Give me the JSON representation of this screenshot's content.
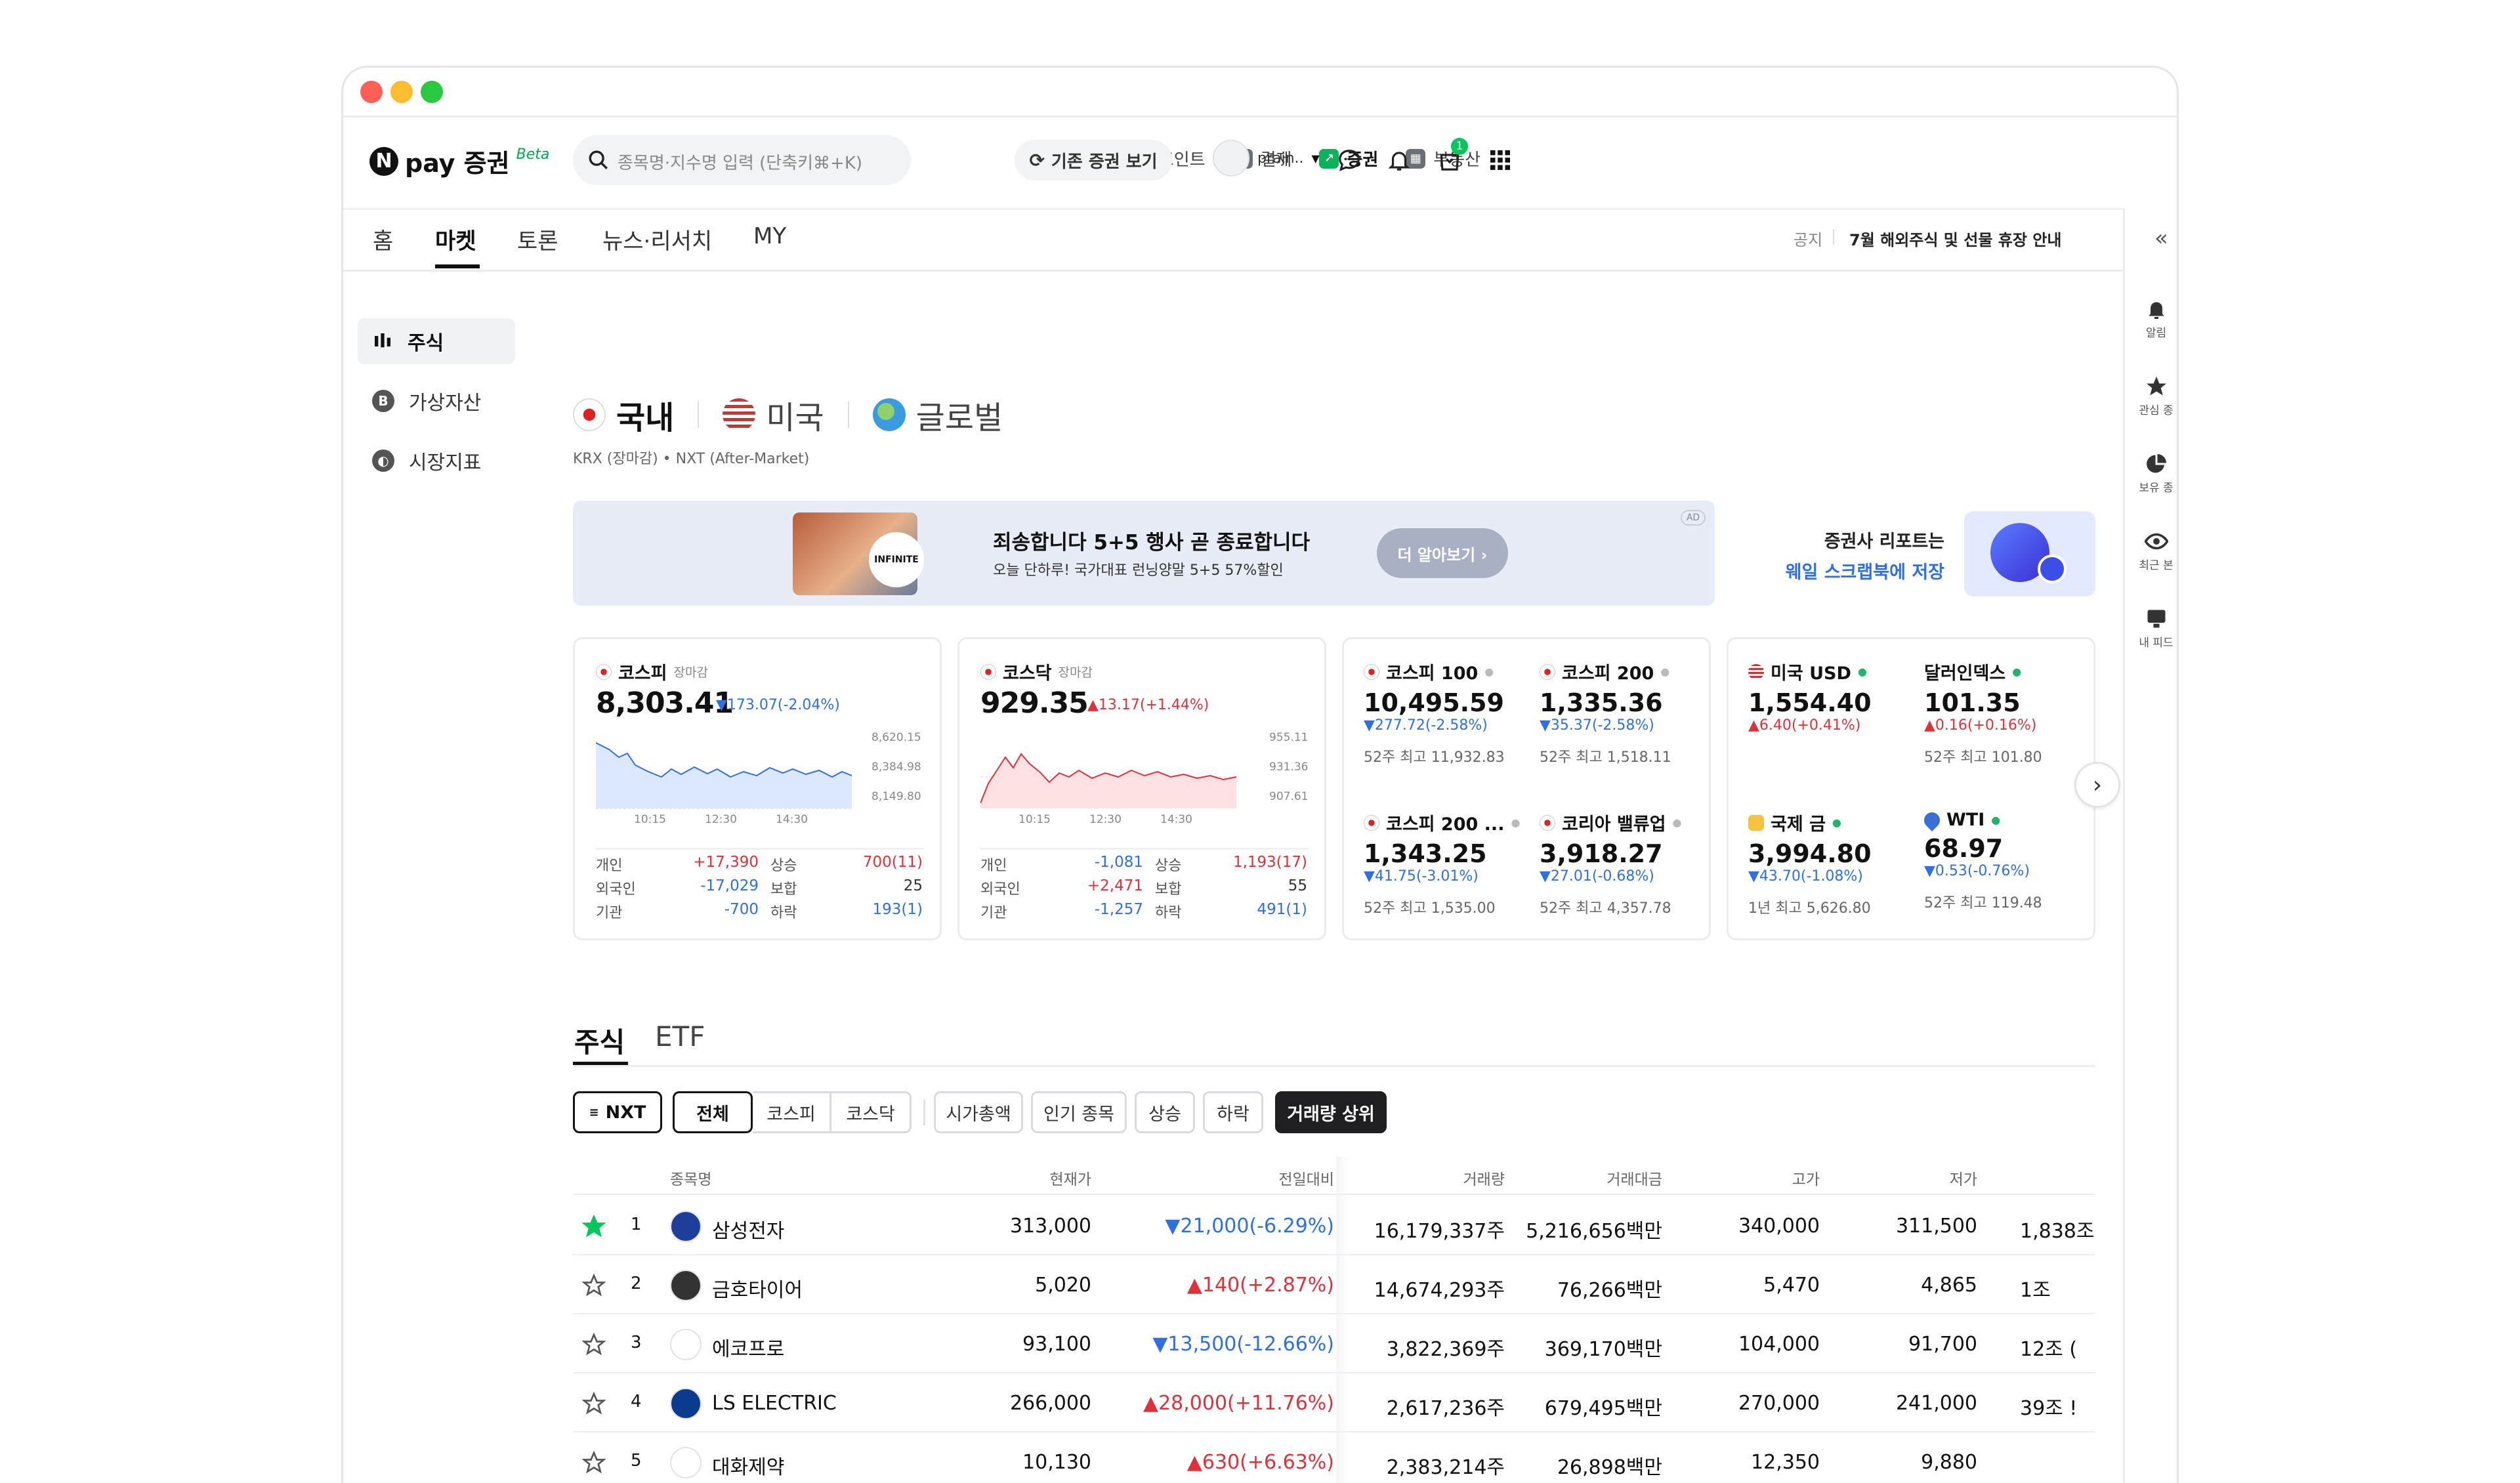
{
  "header": {
    "logo": "pay 증권",
    "logo_badge": "Beta",
    "search_placeholder": "종목명·지수명 입력 (단축키⌘+K)",
    "gnb": [
      {
        "label": "금융",
        "icon": "finance-icon"
      },
      {
        "label": "포인트",
        "icon": "point-icon"
      },
      {
        "label": "결제",
        "icon": "payment-icon"
      },
      {
        "label": "증권",
        "icon": "stock-icon"
      },
      {
        "label": "부동산",
        "icon": "realestate-icon"
      }
    ],
    "legacy_button": "기존 증권 보기",
    "user": "prajn..",
    "notification_badge": "1"
  },
  "tabs": [
    "홈",
    "마켓",
    "토론",
    "뉴스·리서치",
    "MY"
  ],
  "notice": {
    "label": "공지",
    "text": "7월 해외주식 및 선물 휴장 안내"
  },
  "left_nav": [
    "주식",
    "가상자산",
    "시장지표"
  ],
  "markets": [
    "국내",
    "미국",
    "글로벌"
  ],
  "market_sub": "KRX (장마감) • NXT (After-Market)",
  "banner": {
    "title": "죄송합니다 5+5 행사 곧 종료합니다",
    "subtitle": "오늘 단하루! 국가대표 런닝양말 5+5 57%할인",
    "button": "더 알아보기 ›",
    "ad": "AD",
    "brand": "INFINITE",
    "right_line1": "증권사 리포트는",
    "right_line2": "웨일 스크랩북에 저장"
  },
  "cards": {
    "kospi": {
      "name": "코스피",
      "status": "장마감",
      "value": "8,303.41",
      "change": "▼173.07(-2.04%)",
      "yticks": [
        "8,620.15",
        "8,384.98",
        "8,149.80"
      ],
      "xticks": [
        "10:15",
        "12:30",
        "14:30"
      ],
      "stats": [
        [
          "개인",
          "+17,390",
          "상승",
          "700(11)"
        ],
        [
          "외국인",
          "-17,029",
          "보합",
          "25"
        ],
        [
          "기관",
          "-700",
          "하락",
          "193(1)"
        ]
      ]
    },
    "kosdaq": {
      "name": "코스닥",
      "status": "장마감",
      "value": "929.35",
      "change": "▲13.17(+1.44%)",
      "yticks": [
        "955.11",
        "931.36",
        "907.61"
      ],
      "xticks": [
        "10:15",
        "12:30",
        "14:30"
      ],
      "stats": [
        [
          "개인",
          "-1,081",
          "상승",
          "1,193(17)"
        ],
        [
          "외국인",
          "+2,471",
          "보합",
          "55"
        ],
        [
          "기관",
          "-1,257",
          "하락",
          "491(1)"
        ]
      ]
    },
    "indices": [
      {
        "name": "코스피 100",
        "value": "10,495.59",
        "change": "▼277.72(-2.58%)",
        "w52": "52주 최고 11,932.83"
      },
      {
        "name": "코스피 200",
        "value": "1,335.36",
        "change": "▼35.37(-2.58%)",
        "w52": "52주 최고 1,518.11"
      },
      {
        "name": "코스피 200 ...",
        "value": "1,343.25",
        "change": "▼41.75(-3.01%)",
        "w52": "52주 최고 1,535.00"
      },
      {
        "name": "코리아 밸류업",
        "value": "3,918.27",
        "change": "▼27.01(-0.68%)",
        "w52": "52주 최고 4,357.78"
      }
    ],
    "fx": [
      {
        "name": "미국 USD",
        "value": "1,554.40",
        "change": "▲6.40(+0.41%)",
        "w52": ""
      },
      {
        "name": "달러인덱스",
        "value": "101.35",
        "change": "▲0.16(+0.16%)",
        "w52": "52주 최고 101.80"
      },
      {
        "name": "국제 금",
        "value": "3,994.80",
        "change": "▼43.70(-1.08%)",
        "w52": "1년 최고 5,626.80"
      },
      {
        "name": "WTI",
        "value": "68.97",
        "change": "▼0.53(-0.76%)",
        "w52": "52주 최고 119.48"
      }
    ]
  },
  "section_tabs": [
    "주식",
    "ETF"
  ],
  "filters": [
    "NXT",
    "전체",
    "코스피",
    "코스닥",
    "시가총액",
    "인기 종목",
    "상승",
    "하락",
    "거래량 상위"
  ],
  "table": {
    "headers": [
      "종목명",
      "현재가",
      "전일대비",
      "거래량",
      "거래대금",
      "고가",
      "저가"
    ],
    "rows": [
      {
        "rank": "1",
        "name": "삼성전자",
        "price": "313,000",
        "change": "▼21,000(-6.29%)",
        "dir": "down",
        "volume": "16,179,337주",
        "amount": "5,216,656백만",
        "high": "340,000",
        "low": "311,500",
        "cap": "1,838조 (",
        "starred": true
      },
      {
        "rank": "2",
        "name": "금호타이어",
        "price": "5,020",
        "change": "▲140(+2.87%)",
        "dir": "up",
        "volume": "14,674,293주",
        "amount": "76,266백만",
        "high": "5,470",
        "low": "4,865",
        "cap": "1조 ",
        "starred": false
      },
      {
        "rank": "3",
        "name": "에코프로",
        "price": "93,100",
        "change": "▼13,500(-12.66%)",
        "dir": "down",
        "volume": "3,822,369주",
        "amount": "369,170백만",
        "high": "104,000",
        "low": "91,700",
        "cap": "12조 (",
        "starred": false
      },
      {
        "rank": "4",
        "name": "LS ELECTRIC",
        "price": "266,000",
        "change": "▲28,000(+11.76%)",
        "dir": "up",
        "volume": "2,617,236주",
        "amount": "679,495백만",
        "high": "270,000",
        "low": "241,000",
        "cap": "39조 !",
        "starred": false
      },
      {
        "rank": "5",
        "name": "대화제약",
        "price": "10,130",
        "change": "▲630(+6.63%)",
        "dir": "up",
        "volume": "2,383,214주",
        "amount": "26,898백만",
        "high": "12,350",
        "low": "9,880",
        "cap": "",
        "starred": false
      }
    ]
  },
  "right_rail": [
    "알림",
    "관심 종",
    "보유 종",
    "최근 본",
    "내 피드"
  ],
  "colors": {
    "up": "#e2303b",
    "down": "#2f6fe4",
    "accent": "#03c75a",
    "dark": "#1f1f22"
  }
}
